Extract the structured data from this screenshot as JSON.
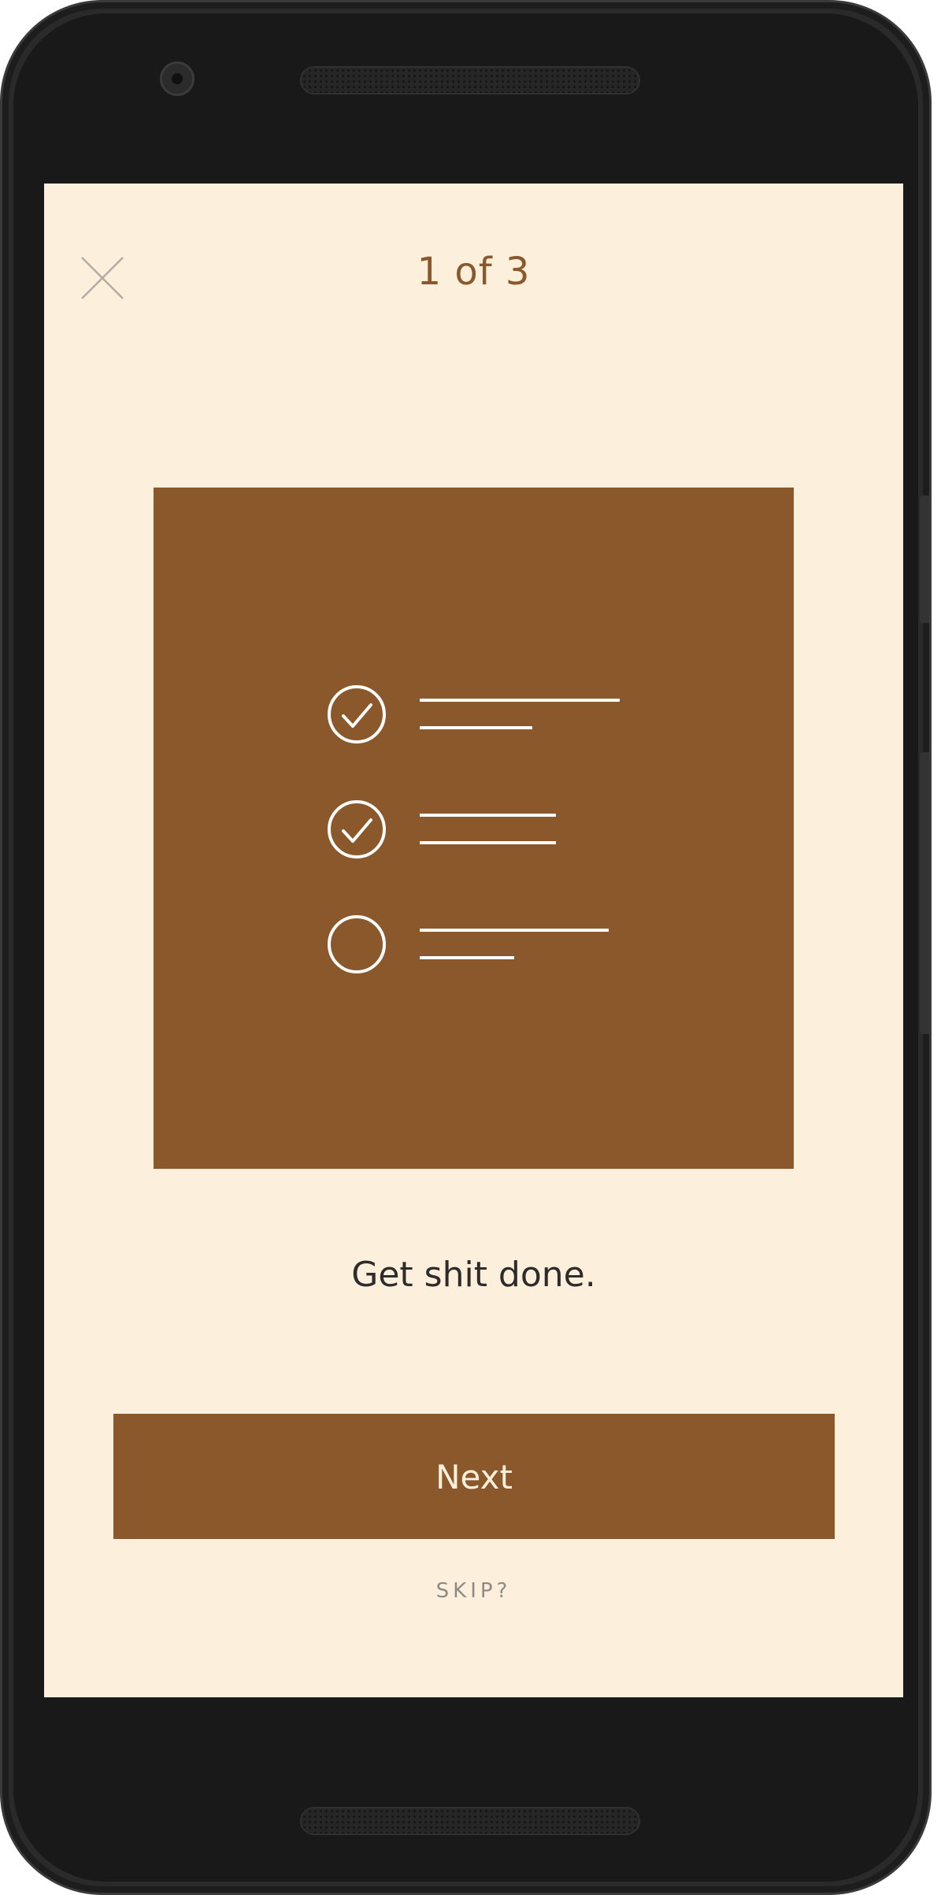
{
  "onboarding": {
    "step_indicator": "1 of 3",
    "headline": "Get shit done.",
    "next_label": "Next",
    "skip_label": "SKIP?"
  },
  "icons": {
    "close": "close-icon",
    "checklist": "checklist-illustration"
  },
  "checklist": {
    "items": [
      {
        "checked": true
      },
      {
        "checked": true
      },
      {
        "checked": false
      }
    ]
  },
  "colors": {
    "background": "#fcf0dd",
    "accent": "#8b582c",
    "headline_text": "#2e2b2a",
    "muted_text": "#8e8a86"
  }
}
